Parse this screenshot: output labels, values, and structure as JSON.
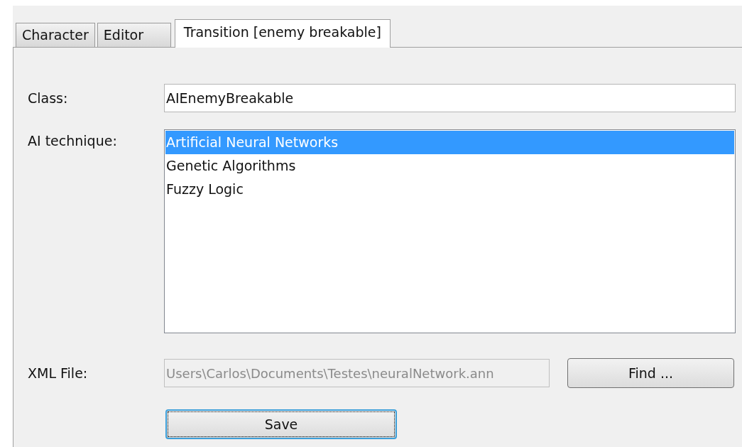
{
  "tabs": [
    {
      "label": "Character",
      "selected": false
    },
    {
      "label": "Editor",
      "selected": false
    },
    {
      "label": "Transition [enemy breakable]",
      "selected": true
    }
  ],
  "class_field": {
    "label": "Class:",
    "value": "AIEnemyBreakable"
  },
  "ai_technique": {
    "label": "AI technique:",
    "items": [
      {
        "label": "Artificial Neural Networks",
        "selected": true
      },
      {
        "label": "Genetic Algorithms",
        "selected": false
      },
      {
        "label": "Fuzzy Logic",
        "selected": false
      }
    ]
  },
  "xml_file": {
    "label": "XML File:",
    "value": "Users\\Carlos\\Documents\\Testes\\neuralNetwork.ann",
    "disabled": true
  },
  "find_button": {
    "label": "Find ..."
  },
  "save_button": {
    "label": "Save",
    "focused": true
  }
}
